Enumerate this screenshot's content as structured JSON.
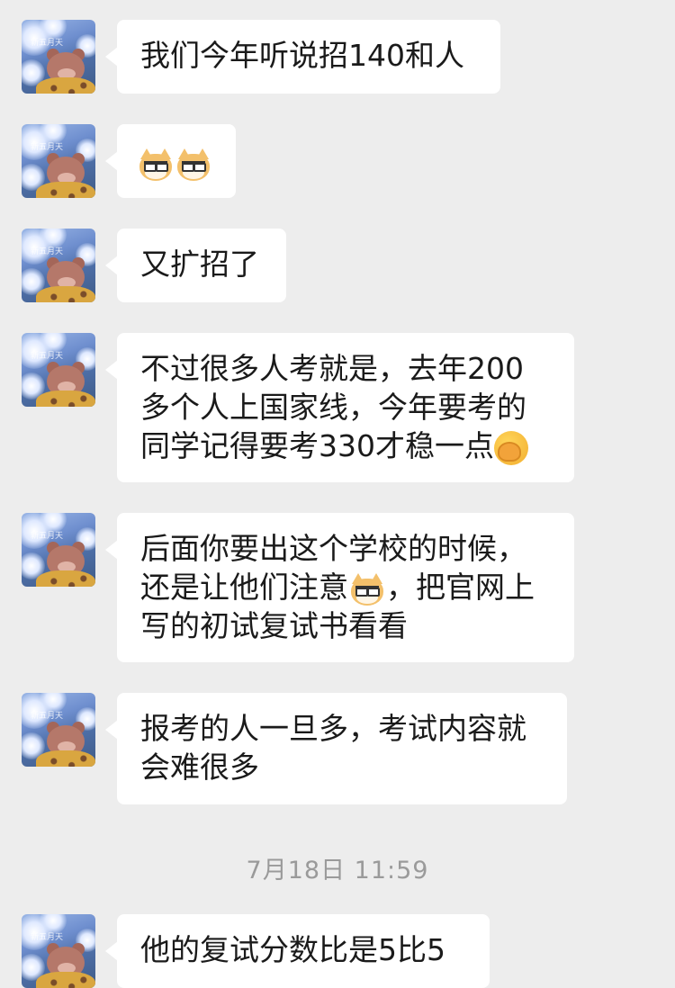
{
  "messages": [
    {
      "lines": [
        "我们今年听说招140和人"
      ]
    },
    {
      "emoji": [
        "cat-face-glasses-emoji",
        "cat-face-glasses-emoji"
      ]
    },
    {
      "lines": [
        "又扩招了"
      ]
    },
    {
      "lines": [
        "不过很多人考就是，去年200",
        "多个人上国家线，今年要考的",
        "同学记得要考330才稳一点"
      ],
      "trailing_emoji": "facepalm-emoji"
    },
    {
      "lines": [
        "后面你要出这个学校的时候，",
        "还是让他们注意",
        "，把官网上",
        "写的初试复试书看看"
      ],
      "inline_emoji": "cat-face-glasses-emoji"
    },
    {
      "lines": [
        "报考的人一旦多，考试内容就",
        "会难很多"
      ]
    },
    {
      "lines": [
        "他的复试分数比是5比5"
      ]
    }
  ],
  "timestamp": "7月18日 11:59",
  "avatar_watermark": "新五月天",
  "colors": {
    "background": "#ededed",
    "bubble": "#ffffff",
    "text": "#1a1a1a",
    "timestamp": "#9a9a9a"
  }
}
